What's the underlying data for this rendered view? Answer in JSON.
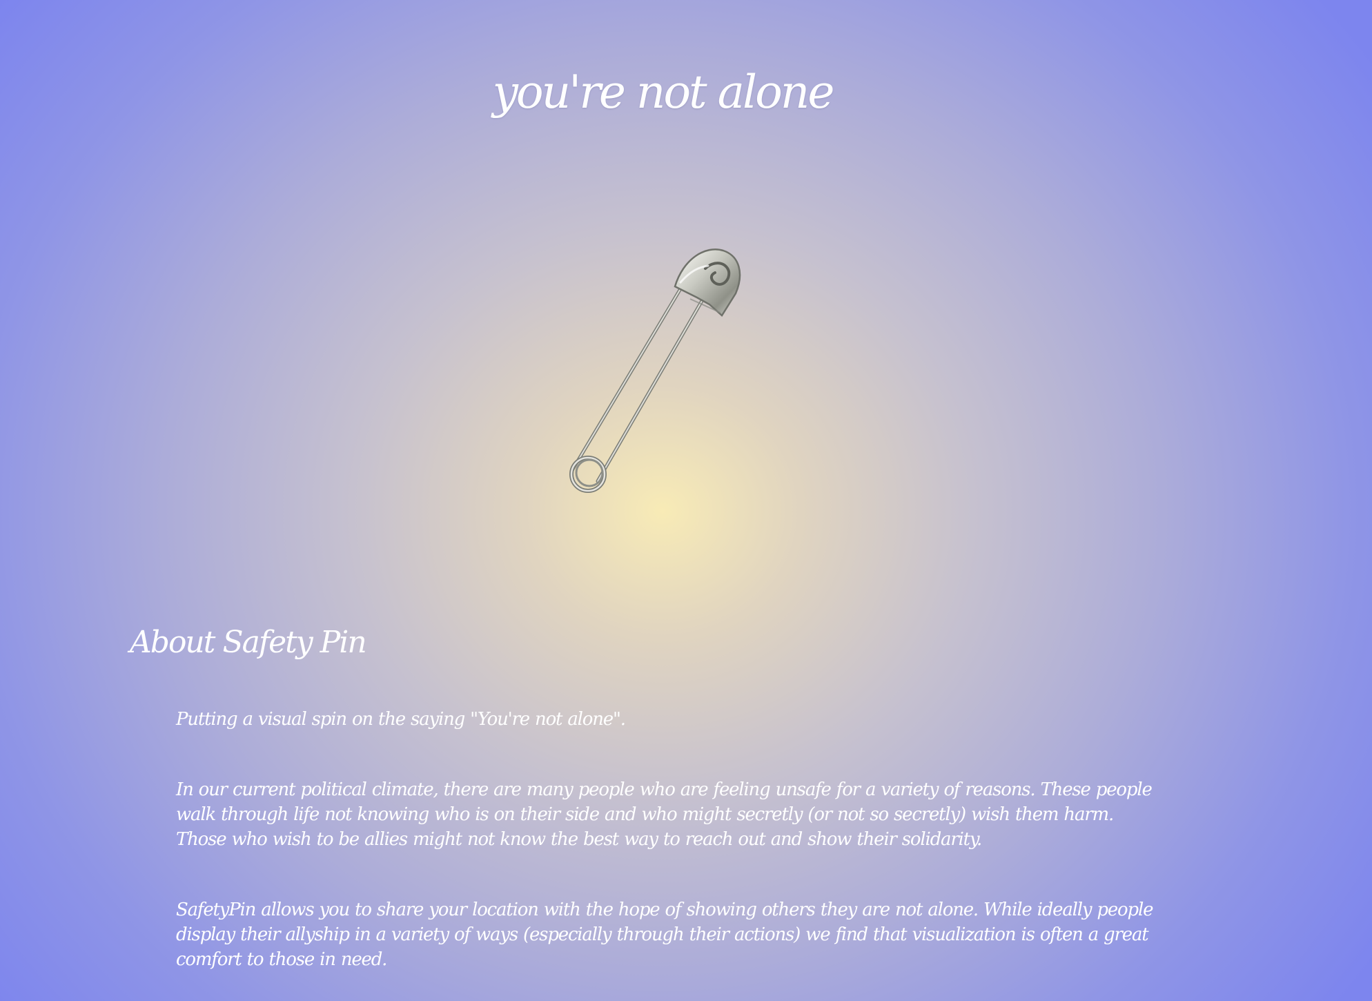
{
  "hero": {
    "title": "you're not alone",
    "image_icon": "safety-pin-icon"
  },
  "about": {
    "heading": "About Safety Pin",
    "paragraphs": [
      "Putting a visual spin on the saying \"You're not alone\".",
      "In our current political climate, there are many people who are feeling unsafe for a variety of reasons. These people walk through life not knowing who is on their side and who might secretly (or not so secretly) wish them harm. Those who wish to be allies might not know the best way to reach out and show their solidarity.",
      "SafetyPin allows you to share your location with the hope of showing others they are not alone. While ideally people display their allyship in a variety of ways (especially through their actions) we find that visualization is often a great comfort to those in need."
    ]
  },
  "colors": {
    "background_center": "#f8ebb6",
    "background_edge": "#7d85ee",
    "text": "#ffffff"
  }
}
